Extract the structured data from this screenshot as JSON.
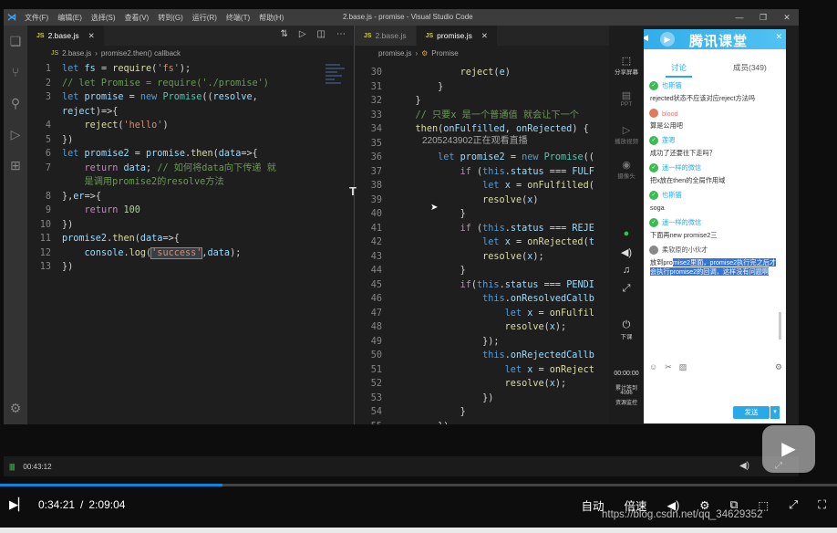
{
  "window": {
    "title": "2.base.js - promise - Visual Studio Code",
    "menu": [
      "文件(F)",
      "编辑(E)",
      "选择(S)",
      "查看(V)",
      "转到(G)",
      "运行(R)",
      "终端(T)",
      "帮助(H)"
    ]
  },
  "left_editor": {
    "tab": "2.base.js",
    "breadcrumb_file": "2.base.js",
    "breadcrumb_symbol": "promise2.then() callback"
  },
  "right_editor": {
    "tabs": [
      "2.base.js",
      "promise.js"
    ],
    "breadcrumb_file": "promise.js",
    "breadcrumb_symbol": "Promise"
  },
  "overlay": {
    "watermark": "2205243902正在观看直播"
  },
  "tencent": {
    "brand": "腾讯课堂",
    "tab_discuss": "讨论",
    "tab_members": "成员(349)",
    "side": {
      "share": "分享屏幕",
      "ppt": "PPT",
      "video": "播放视频",
      "camera": "摄像头",
      "end": "下课",
      "timer": "00:00:00",
      "stats1": "累计答到",
      "stats2": "4096",
      "stats3": "资源监控"
    },
    "messages": [
      {
        "who": "也斯猫",
        "text": "rejected状态不应该对应reject方法吗"
      },
      {
        "who": "blood",
        "text": "算是公用吧"
      },
      {
        "who": "莲嗯",
        "text": "成功了还要往下走吗？"
      },
      {
        "who": "迷一样的微信",
        "text": "把x放在then的全局作用域"
      },
      {
        "who": "也斯猫",
        "text": "soga"
      },
      {
        "who": "迷一样的微信",
        "text": "下面再new promise2三"
      },
      {
        "who": "柔软原的小伙才",
        "text_a": "放到pro",
        "text_b": "mise2里面，promise2执行完之后才会执行promise2的回调，这样没有问题啊"
      }
    ],
    "send": "发送"
  },
  "status": {
    "time": "00:43:12"
  },
  "player": {
    "current": "0:34:21",
    "sep": "/",
    "total": "2:09:04",
    "progress": 0.266,
    "auto": "自动",
    "speed": "倍速"
  },
  "footer": {
    "csdn": "https://blog.csdn.net/qq_34629352"
  }
}
